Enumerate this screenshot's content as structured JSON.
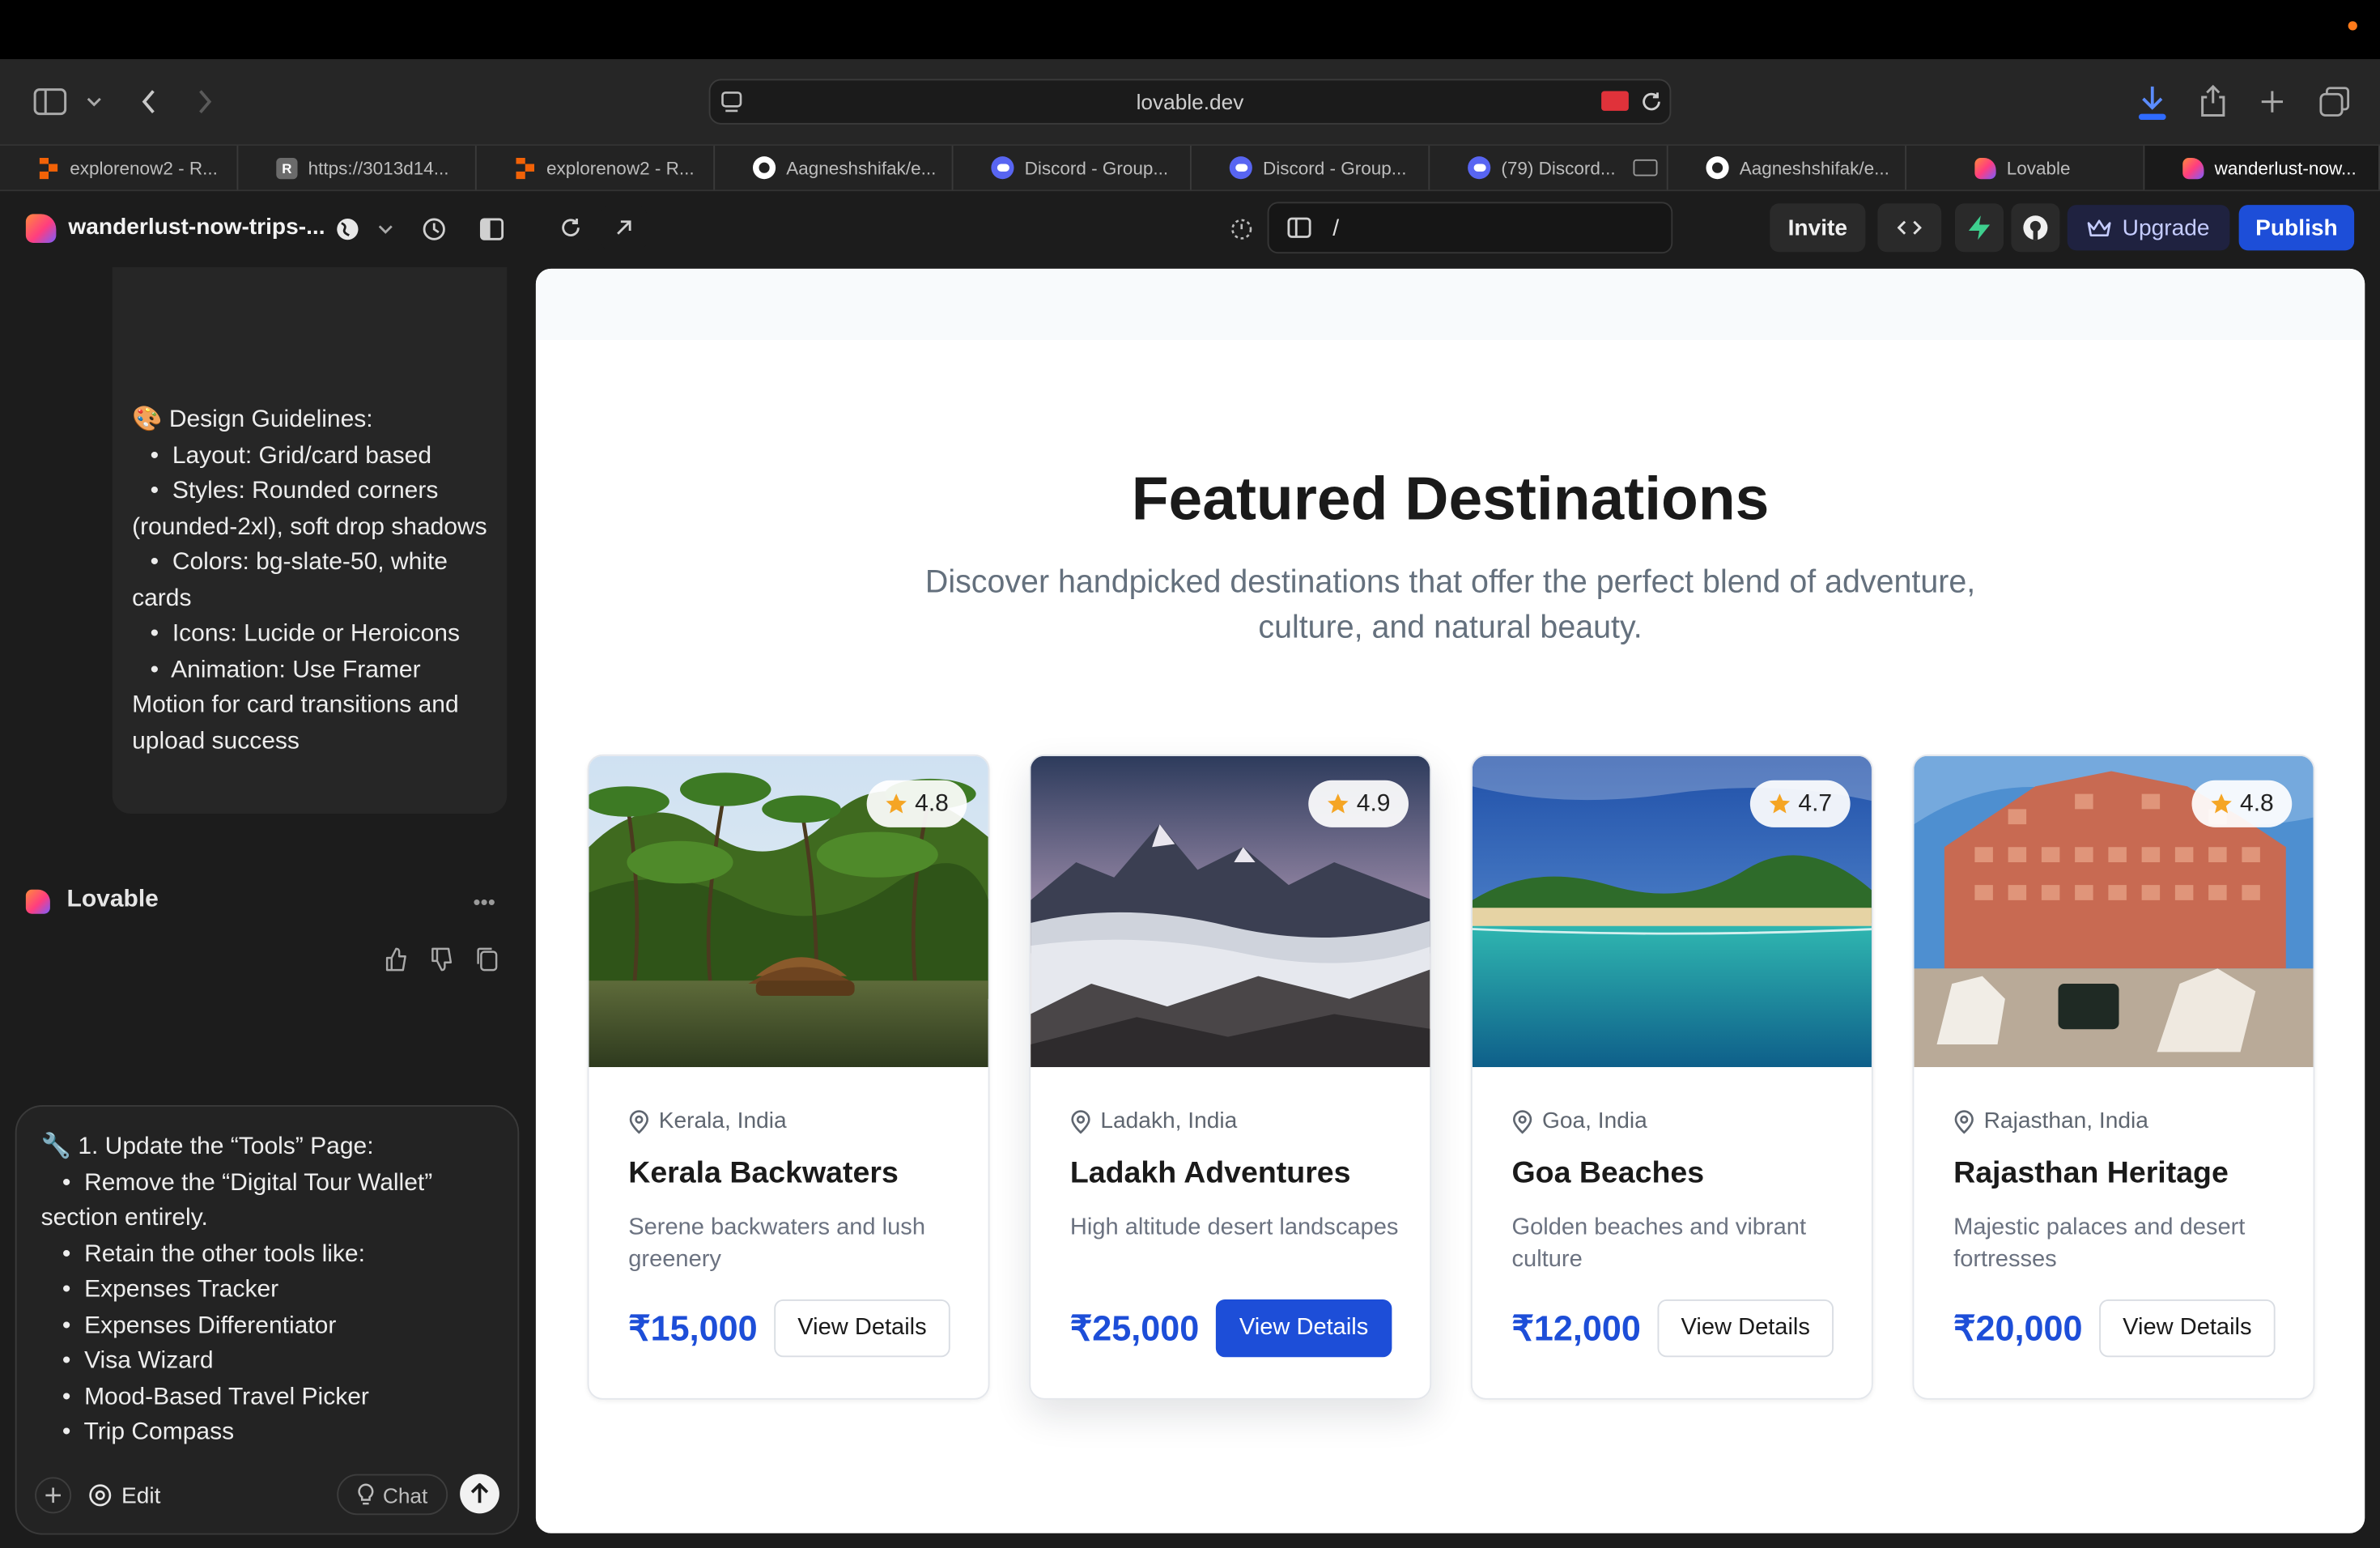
{
  "browser": {
    "url": "lovable.dev",
    "tabs": [
      {
        "label": "explorenow2 - R...",
        "icon": "replit-icon",
        "color": "#f26207"
      },
      {
        "label": "https://3013d14...",
        "icon": "r-icon",
        "color": "#6b6b6b"
      },
      {
        "label": "explorenow2 - R...",
        "icon": "replit-icon",
        "color": "#f26207"
      },
      {
        "label": "Aagneshshifak/e...",
        "icon": "github-icon",
        "color": "#ffffff"
      },
      {
        "label": "Discord - Group...",
        "icon": "discord-icon",
        "color": "#5865f2"
      },
      {
        "label": "Discord - Group...",
        "icon": "discord-icon",
        "color": "#5865f2"
      },
      {
        "label": "(79) Discord...",
        "icon": "discord-icon",
        "color": "#5865f2"
      },
      {
        "label": "Aagneshshifak/e...",
        "icon": "github-icon",
        "color": "#ffffff"
      },
      {
        "label": "Lovable",
        "icon": "lovable-icon",
        "color": "#ff4d6d"
      },
      {
        "label": "wanderlust-now...",
        "icon": "lovable-icon",
        "color": "#ff4d6d"
      }
    ]
  },
  "appbar": {
    "project_title": "wanderlust-now-trips-...",
    "path": "/",
    "invite_label": "Invite",
    "upgrade_label": "Upgrade",
    "publish_label": "Publish"
  },
  "chat": {
    "guidelines_title": "🎨 Design Guidelines:",
    "guidelines": [
      "Layout: Grid/card based",
      "Styles: Rounded corners (rounded-2xl), soft drop shadows",
      "Colors: bg-slate-50, white cards",
      "Icons: Lucide or Heroicons",
      "Animation: Use Framer Motion for card transitions and upload success"
    ],
    "bot_name": "Lovable",
    "composer_title": "🔧 1. Update the “Tools” Page:",
    "composer_items": [
      "Remove the “Digital Tour Wallet” section entirely.",
      "Retain the other tools like:",
      "Expenses Tracker",
      "Expenses Differentiator",
      "Visa Wizard",
      "Mood-Based Travel Picker",
      "Trip Compass"
    ],
    "edit_label": "Edit",
    "chat_label": "Chat"
  },
  "preview": {
    "heading": "Featured Destinations",
    "subheading": "Discover handpicked destinations that offer the perfect blend of adventure, culture, and natural beauty.",
    "cards": [
      {
        "rating": "4.8",
        "location": "Kerala, India",
        "name": "Kerala Backwaters",
        "desc": "Serene backwaters and lush greenery",
        "price": "₹15,000",
        "button": "View Details"
      },
      {
        "rating": "4.9",
        "location": "Ladakh, India",
        "name": "Ladakh Adventures",
        "desc": "High altitude desert landscapes",
        "price": "₹25,000",
        "button": "View Details"
      },
      {
        "rating": "4.7",
        "location": "Goa, India",
        "name": "Goa Beaches",
        "desc": "Golden beaches and vibrant culture",
        "price": "₹12,000",
        "button": "View Details"
      },
      {
        "rating": "4.8",
        "location": "Rajasthan, India",
        "name": "Rajasthan Heritage",
        "desc": "Majestic palaces and desert fortresses",
        "price": "₹20,000",
        "button": "View Details"
      }
    ]
  },
  "colors": {
    "accent": "#1d4ed8",
    "star": "#f5a524",
    "recording_dot": "#ff7a1a"
  }
}
